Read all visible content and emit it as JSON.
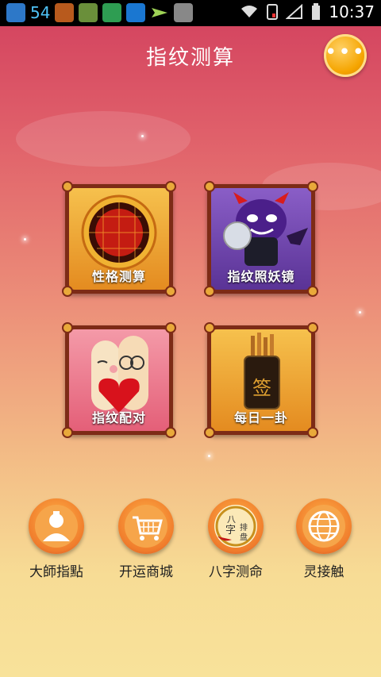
{
  "status_bar": {
    "notification_count": "54",
    "time": "10:37"
  },
  "header": {
    "title": "指纹测算",
    "menu_icon": "more-dots-icon"
  },
  "tiles": [
    {
      "label": "性格测算",
      "icon": "radar-globe-icon"
    },
    {
      "label": "指纹照妖镜",
      "icon": "devil-mirror-icon"
    },
    {
      "label": "指纹配对",
      "icon": "finger-couple-heart-icon"
    },
    {
      "label": "每日一卦",
      "icon": "fortune-sticks-icon"
    }
  ],
  "bottom_nav": [
    {
      "label": "大師指點",
      "icon": "master-icon"
    },
    {
      "label": "开运商城",
      "icon": "shopping-cart-icon"
    },
    {
      "label": "八字测命",
      "icon": "bazi-plate-icon",
      "badge_text": [
        "八",
        "字",
        "排",
        "盘"
      ]
    },
    {
      "label": "灵接触",
      "icon": "globe-icon"
    }
  ],
  "colors": {
    "accent": "#f07c2c",
    "tile_frame": "#7d2b16",
    "tile_gold": "#e9a93a"
  }
}
